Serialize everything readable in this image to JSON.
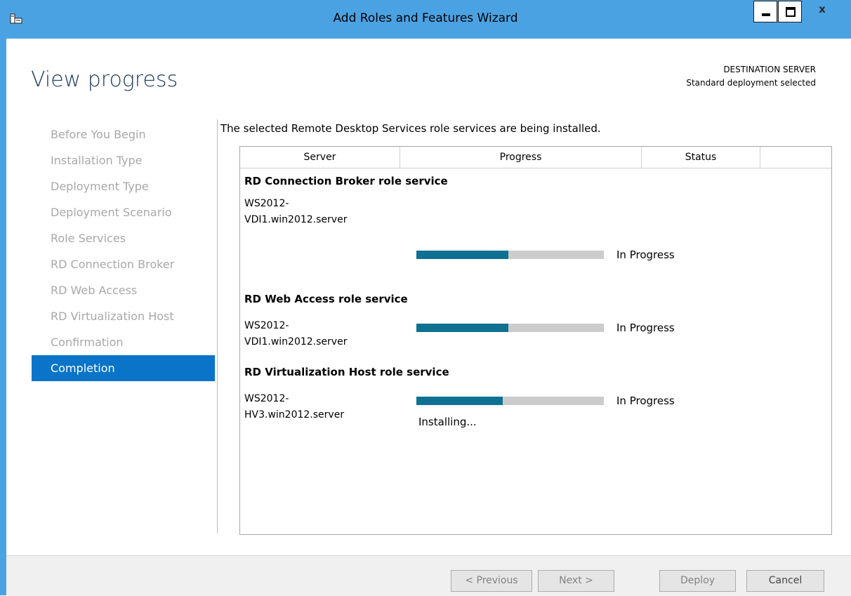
{
  "window": {
    "title": "Add Roles and Features Wizard",
    "icons": {
      "app": "server-manager-icon",
      "minimize": "minimize-icon",
      "maximize": "maximize-icon",
      "close": "close-icon"
    },
    "close_glyph": "x"
  },
  "page": {
    "title": "View progress",
    "destination_label": "DESTINATION SERVER",
    "destination_value": "Standard deployment selected"
  },
  "nav": {
    "items": [
      {
        "label": "Before You Begin",
        "active": false
      },
      {
        "label": "Installation Type",
        "active": false
      },
      {
        "label": "Deployment Type",
        "active": false
      },
      {
        "label": "Deployment Scenario",
        "active": false
      },
      {
        "label": "Role Services",
        "active": false
      },
      {
        "label": "RD Connection Broker",
        "active": false
      },
      {
        "label": "RD Web Access",
        "active": false
      },
      {
        "label": "RD Virtualization Host",
        "active": false
      },
      {
        "label": "Confirmation",
        "active": false
      },
      {
        "label": "Completion",
        "active": true
      }
    ]
  },
  "main": {
    "intro": "The selected Remote Desktop Services role services are being installed.",
    "columns": [
      "Server",
      "Progress",
      "Status",
      ""
    ],
    "groups": [
      {
        "title": "RD Connection Broker role service",
        "server_line1": "WS2012-",
        "server_line2": "VDI1.win2012.server",
        "progress": 0.49,
        "status": "In Progress",
        "substatus": ""
      },
      {
        "title": "RD Web Access role service",
        "server_line1": "WS2012-",
        "server_line2": "VDI1.win2012.server",
        "progress": 0.49,
        "status": "In Progress",
        "substatus": ""
      },
      {
        "title": "RD Virtualization Host role service",
        "server_line1": "WS2012-",
        "server_line2": "HV3.win2012.server",
        "progress": 0.46,
        "status": "In Progress",
        "substatus": "Installing..."
      }
    ]
  },
  "footer": {
    "previous_label": "< Previous",
    "next_label": "Next >",
    "deploy_label": "Deploy",
    "cancel_label": "Cancel"
  },
  "colors": {
    "titlebar": "#4ba2e3",
    "accent": "#0a74c9",
    "progress_fill": "#0e7191",
    "progress_track": "#cccccc"
  }
}
